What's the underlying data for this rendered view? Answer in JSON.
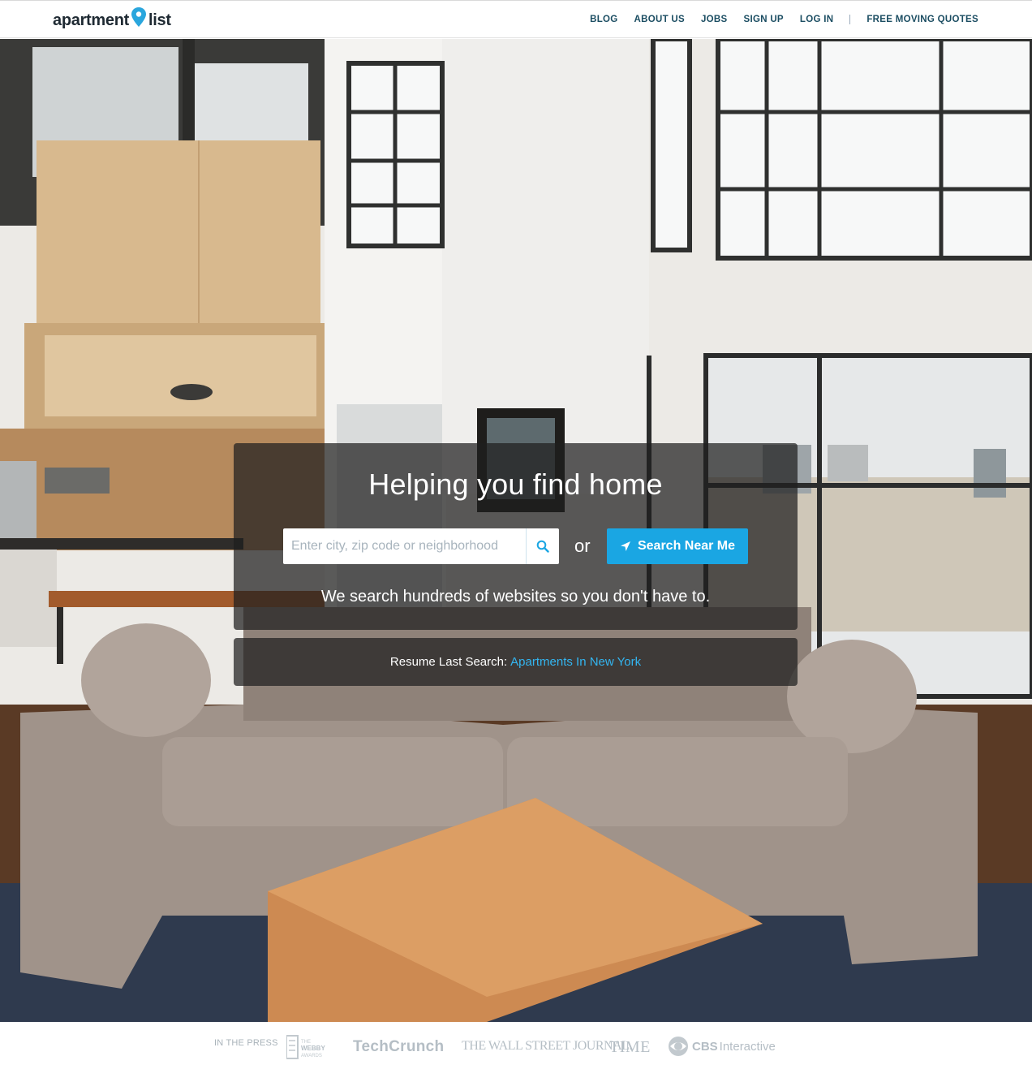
{
  "header": {
    "logo_left": "apartment",
    "logo_right": "list",
    "nav": [
      "BLOG",
      "ABOUT US",
      "JOBS",
      "SIGN UP",
      "LOG IN"
    ],
    "nav_extra": "FREE MOVING QUOTES"
  },
  "hero": {
    "title": "Helping you find home",
    "search_placeholder": "Enter city, zip code or neighborhood",
    "or_text": "or",
    "near_button": "Search Near Me",
    "tagline": "We search hundreds of websites so you don't have to."
  },
  "resume": {
    "label": "Resume Last Search:",
    "link": "Apartments In New York"
  },
  "press": {
    "label": "IN THE PRESS",
    "webby_the": "THE",
    "webby_name": "WEBBY",
    "webby_awards": "AWARDS",
    "techcrunch": "TechCrunch",
    "wsj": "THE WALL STREET JOURNAL.",
    "time": "TIME",
    "cbs_bold": "CBS",
    "cbs_rest": "Interactive"
  },
  "colors": {
    "accent": "#1aa6e3",
    "link": "#33b5f0",
    "nav": "#1b4d62"
  },
  "icons": [
    "map-pin-icon",
    "search-icon",
    "location-arrow-icon",
    "cbs-eye-icon"
  ]
}
